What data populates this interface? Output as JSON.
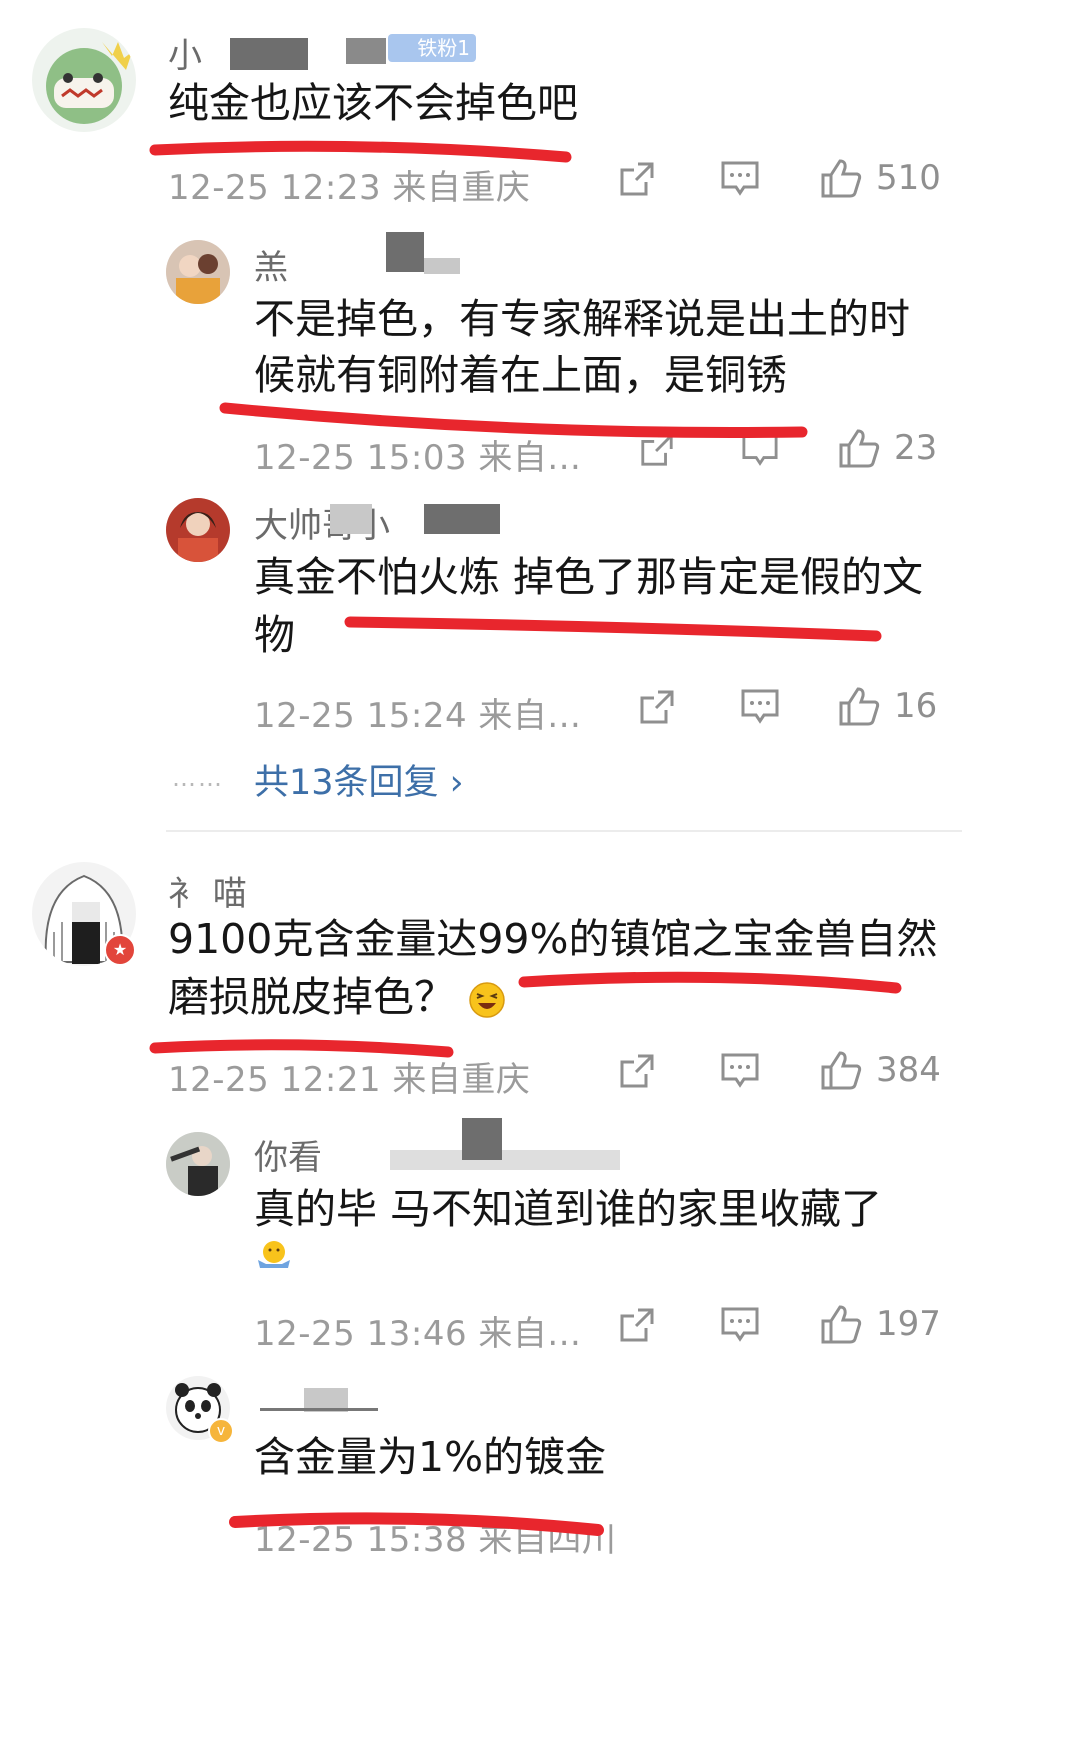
{
  "comments": [
    {
      "name": "小",
      "text_lines": [
        "纯金也应该不会掉色吧"
      ],
      "time": "12-25 12:23",
      "location": "来自重庆",
      "likes": "510",
      "replies": [
        {
          "name": "羔",
          "text_lines": [
            "不是掉色，有专家解释说是出土的时",
            "候就有铜附着在上面，是铜锈"
          ],
          "time": "12-25 15:03",
          "location": "来自...",
          "likes": "23"
        },
        {
          "name": "大帅哥小",
          "text_lines": [
            "真金不怕火炼 掉色了那肯定是假的文",
            "物"
          ],
          "time": "12-25 15:24",
          "location": "来自...",
          "likes": "16"
        }
      ],
      "more_replies": "共13条回复 ›",
      "more_dots": "……"
    },
    {
      "name": "衤  喵",
      "text_lines": [
        "9100克含金量达99%的镇馆之宝金兽自然",
        "磨损脱皮掉色？"
      ],
      "time": "12-25 12:21",
      "location": "来自重庆",
      "likes": "384",
      "replies": [
        {
          "name": "你看",
          "text_lines": [
            "真的毕  马不知道到谁的家里收藏了"
          ],
          "time": "12-25 13:46",
          "location": "来自...",
          "likes": "197"
        },
        {
          "name": "",
          "text_lines": [
            "含金量为1%的镀金"
          ],
          "time": "12-25 15:38",
          "location": "来自四川",
          "likes": ""
        }
      ]
    }
  ],
  "badge": "铁粉1",
  "icons": [
    "share-icon",
    "comment-icon",
    "like-icon",
    "laughing-emoji-icon",
    "shrug-emoji-icon",
    "verified-badge-icon"
  ],
  "colors": {
    "underline": "#e8262d",
    "link": "#3d6fa8",
    "meta": "#9b9b9b"
  }
}
